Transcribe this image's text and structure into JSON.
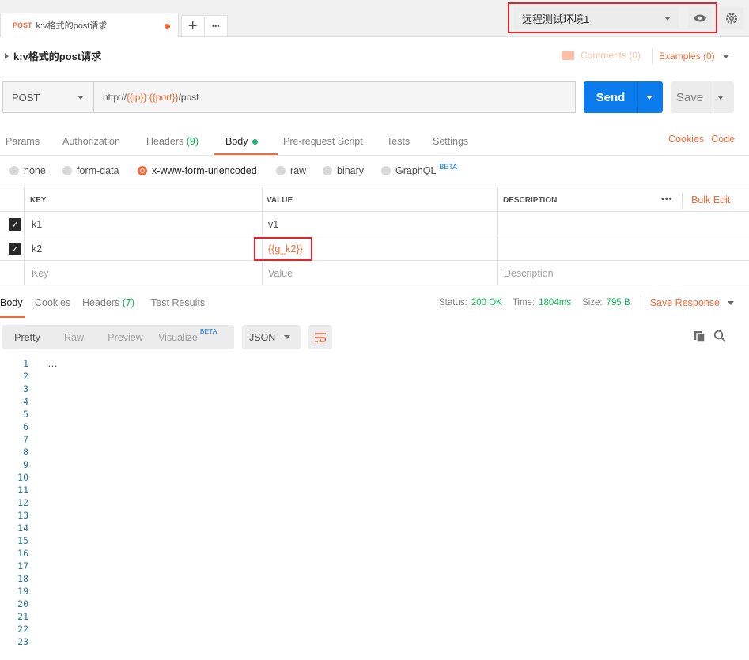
{
  "tab": {
    "method": "POST",
    "title": "k:v格式的post请求",
    "new": "+",
    "more": "•••"
  },
  "env": {
    "selected": "远程测试环境1"
  },
  "req": {
    "name": "k:v格式的post请求",
    "comments": "Comments (0)",
    "examples": "Examples (0)"
  },
  "url": {
    "method": "POST",
    "prefix": "http://",
    "v1": "{{ip}}",
    "sep": ":",
    "v2": "{{port}}",
    "path": "/post",
    "send": "Send",
    "save": "Save"
  },
  "tabs": {
    "params": "Params",
    "auth": "Authorization",
    "headers": "Headers",
    "hcount": "(9)",
    "body": "Body",
    "pre": "Pre-request Script",
    "tests": "Tests",
    "settings": "Settings",
    "cookies": "Cookies",
    "code": "Code"
  },
  "modes": {
    "none": "none",
    "form": "form-data",
    "urlenc": "x-www-form-urlencoded",
    "raw": "raw",
    "binary": "binary",
    "graphql": "GraphQL",
    "beta": "BETA"
  },
  "table": {
    "key": "KEY",
    "value": "VALUE",
    "desc": "DESCRIPTION",
    "bulk": "Bulk Edit",
    "more": "•••",
    "rows": [
      {
        "k": "k1",
        "v": "v1"
      },
      {
        "k": "k2",
        "v": "{{g_k2}}"
      }
    ],
    "ph": {
      "k": "Key",
      "v": "Value",
      "d": "Description"
    }
  },
  "resp": {
    "body": "Body",
    "cookies": "Cookies",
    "headers": "Headers",
    "hcount": "(7)",
    "results": "Test Results",
    "status_l": "Status:",
    "status": "200 OK",
    "time_l": "Time:",
    "time": "1804ms",
    "size_l": "Size:",
    "size": "795 B",
    "save": "Save Response"
  },
  "view": {
    "pretty": "Pretty",
    "raw": "Raw",
    "preview": "Preview",
    "visualize": "Visualize",
    "beta": "BETA",
    "fmt": "JSON"
  },
  "lines": [
    "1",
    "2",
    "3",
    "4",
    "5",
    "6",
    "7",
    "8",
    "9",
    "10",
    "11",
    "12",
    "13",
    "14",
    "15",
    "16",
    "17",
    "18",
    "19",
    "20",
    "21",
    "22",
    "23"
  ]
}
